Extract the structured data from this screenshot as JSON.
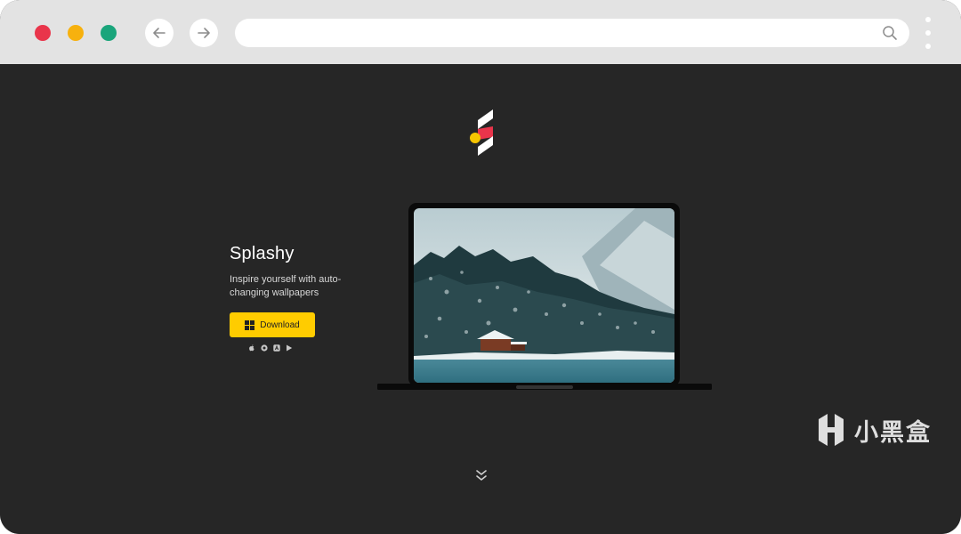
{
  "browser": {
    "url": "",
    "controls": {
      "close_color": "#e9354b",
      "minimize_color": "#f7b10e",
      "maximize_color": "#1aa57b"
    },
    "icons": {
      "back": "arrow-left-icon",
      "forward": "arrow-right-icon",
      "search": "search-icon",
      "menu": "kebab-menu-icon"
    }
  },
  "page": {
    "background": "#262626",
    "logo_icon": "splashy-logo-icon",
    "hero": {
      "title": "Splashy",
      "tagline": "Inspire yourself with auto-changing wallpapers",
      "download_label": "Download",
      "download_icon": "windows-icon",
      "accent": "#ffcc00",
      "platform_icons": [
        "apple-icon",
        "chrome-icon",
        "app-store-icon",
        "play-store-icon"
      ]
    },
    "preview": {
      "device": "laptop",
      "wallpaper": "snowy forest cabin by a lake"
    },
    "scroll_hint_icon": "double-chevron-down-icon"
  },
  "watermark": {
    "text": "小黑盒",
    "icon": "heybox-logo-icon"
  }
}
